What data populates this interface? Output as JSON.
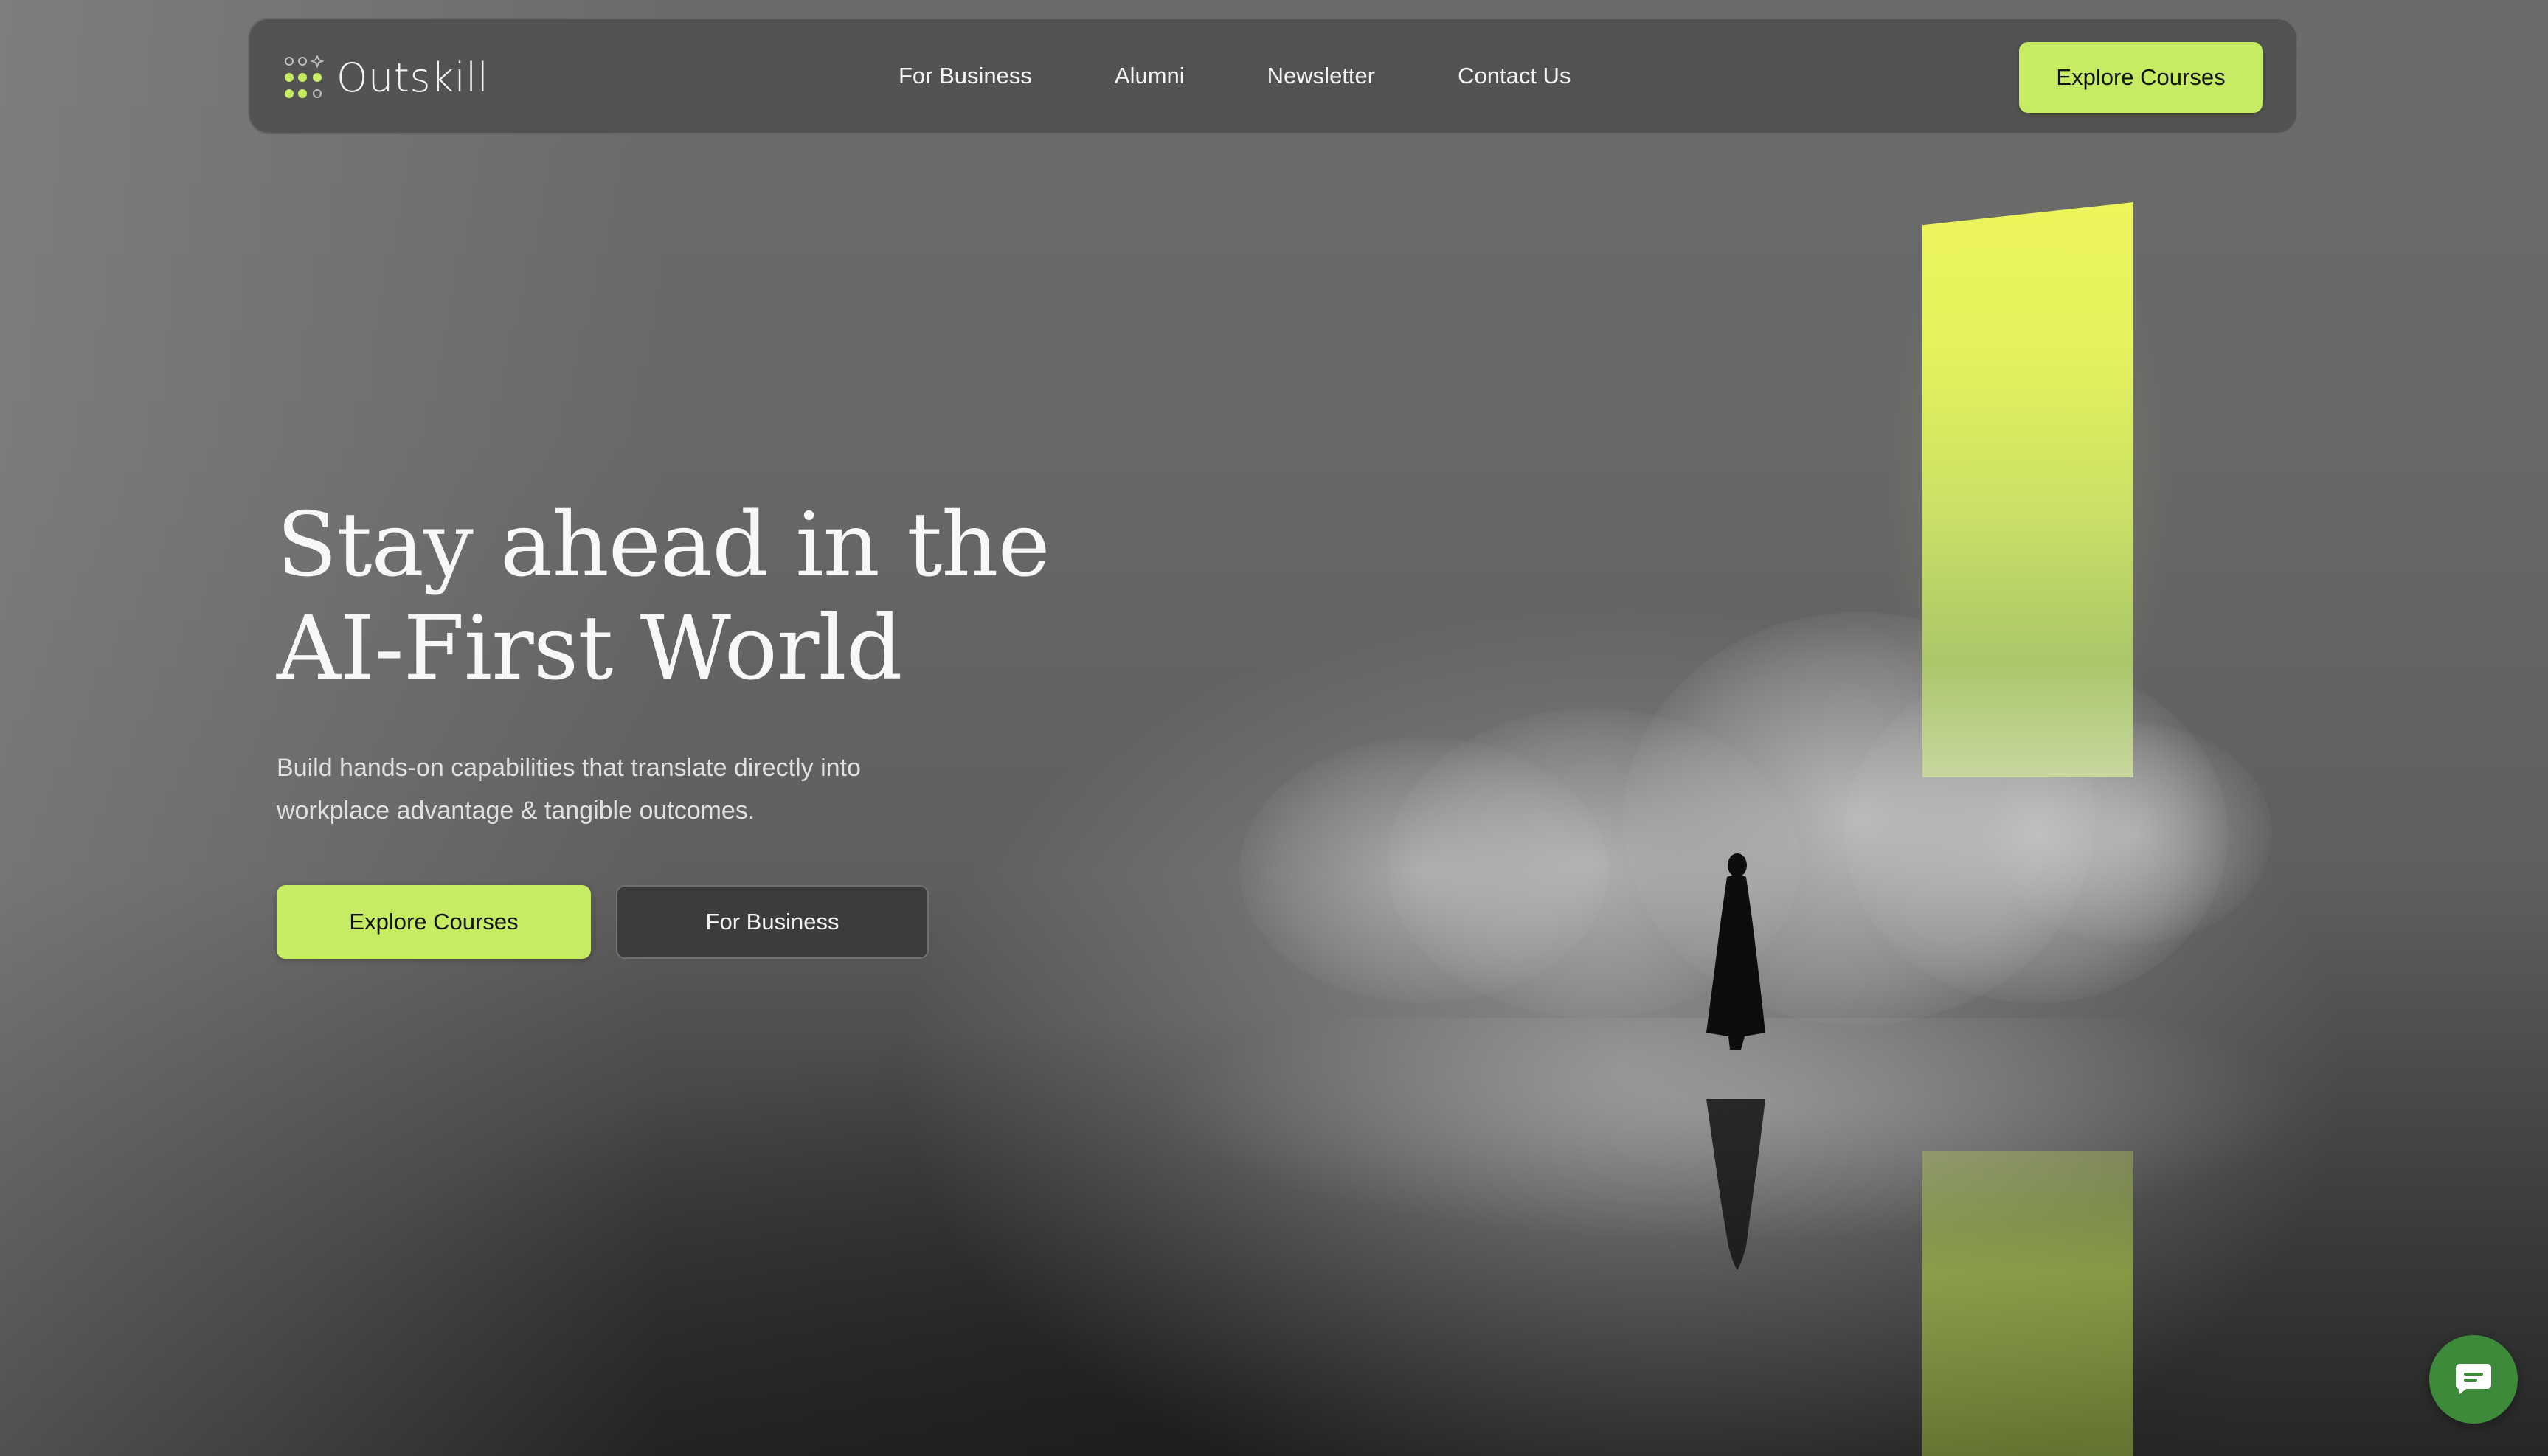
{
  "brand": {
    "name": "Outskill",
    "logo_icon": "dot-grid-sparkle-icon",
    "accent_color": "#c6ec63"
  },
  "nav": {
    "links": [
      {
        "label": "For Business"
      },
      {
        "label": "Alumni"
      },
      {
        "label": "Newsletter"
      },
      {
        "label": "Contact Us"
      }
    ],
    "cta_label": "Explore Courses"
  },
  "hero": {
    "title_line1": "Stay ahead in the",
    "title_line2": "AI-First World",
    "subtitle_line1": "Build hands-on capabilities that translate directly into",
    "subtitle_line2": "workplace advantage & tangible outcomes.",
    "primary_button": "Explore Courses",
    "secondary_button": "For Business",
    "image": {
      "description_icon": "portal-figure-illustration",
      "portal_color": "#e8f25a"
    }
  },
  "chat": {
    "icon": "chat-bubble-icon",
    "color": "#3c8a3a"
  }
}
